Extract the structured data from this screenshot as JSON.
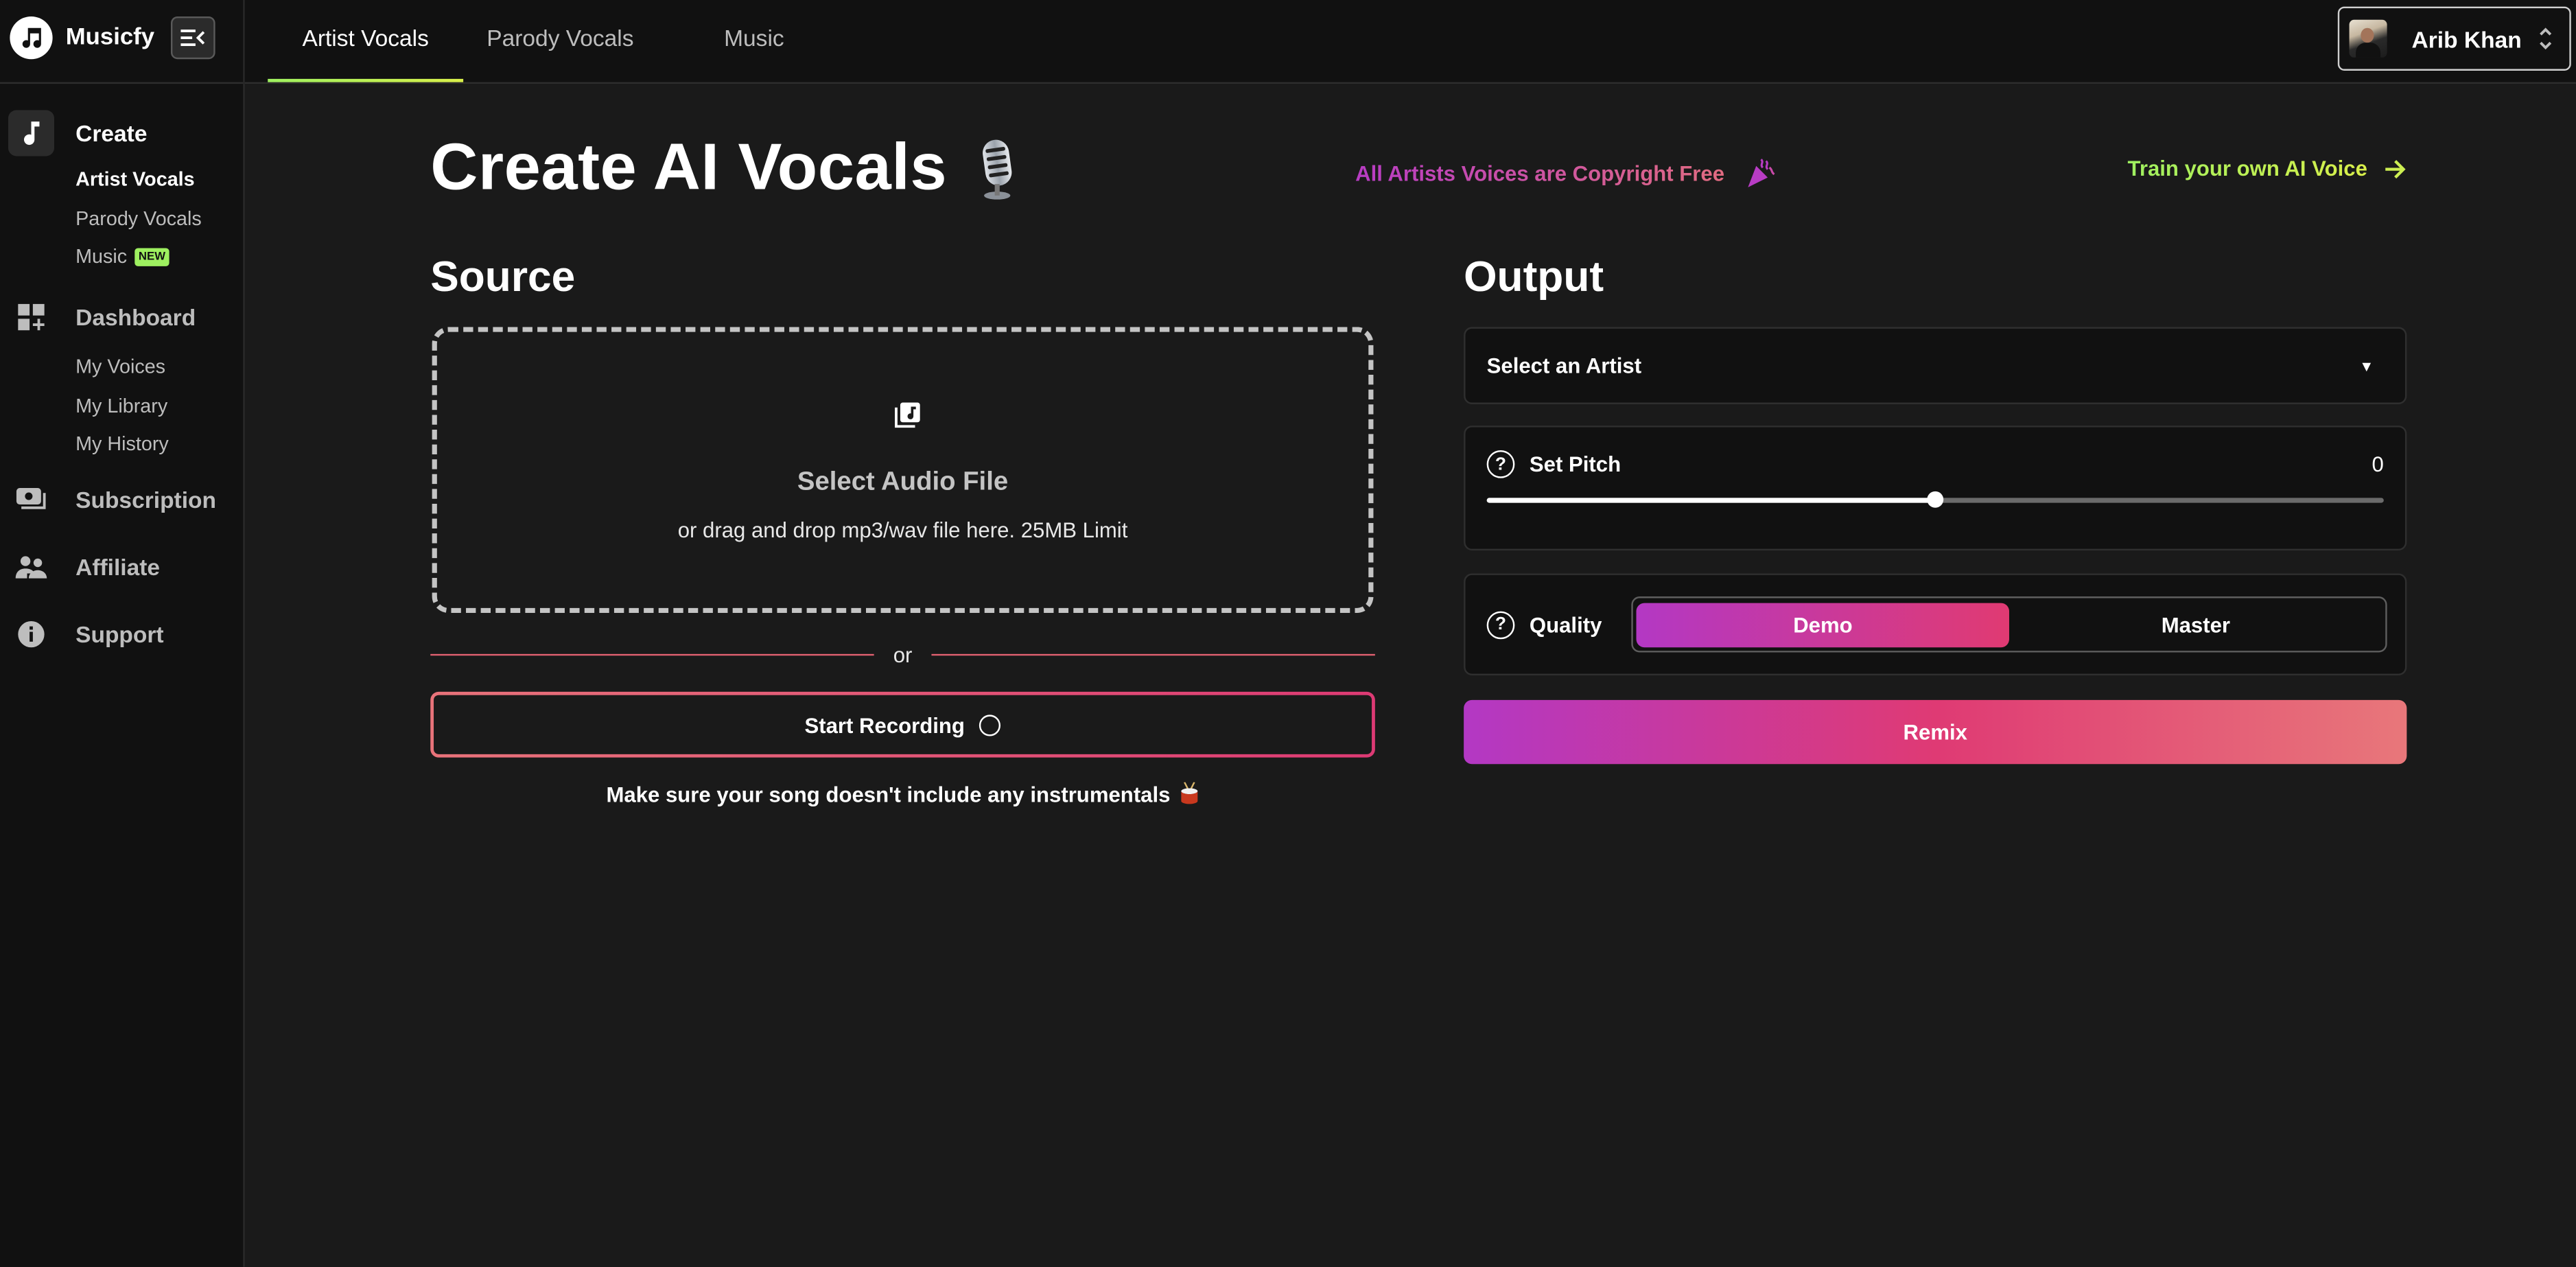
{
  "app": {
    "name": "Musicfy"
  },
  "sidebar": {
    "sections": [
      {
        "label": "Create",
        "icon": "music-note-icon",
        "active": true,
        "items": [
          {
            "label": "Artist Vocals",
            "active": true
          },
          {
            "label": "Parody Vocals"
          },
          {
            "label": "Music",
            "badge": "NEW"
          }
        ]
      },
      {
        "label": "Dashboard",
        "icon": "dashboard-add-icon",
        "items": [
          {
            "label": "My Voices"
          },
          {
            "label": "My Library"
          },
          {
            "label": "My History"
          }
        ]
      },
      {
        "label": "Subscription",
        "icon": "payments-icon",
        "items": []
      },
      {
        "label": "Affiliate",
        "icon": "people-icon",
        "items": []
      },
      {
        "label": "Support",
        "icon": "info-icon",
        "items": []
      }
    ]
  },
  "topbar": {
    "tabs": [
      {
        "label": "Artist Vocals",
        "active": true
      },
      {
        "label": "Parody Vocals"
      },
      {
        "label": "Music"
      }
    ],
    "user": {
      "name": "Arib Khan"
    }
  },
  "main": {
    "title": "Create AI Vocals",
    "title_emoji": "studio-microphone",
    "copyright_note": "All Artists Voices are Copyright Free",
    "train_link": "Train your own AI Voice",
    "source": {
      "heading": "Source",
      "dropzone_title": "Select Audio File",
      "dropzone_subtitle": "or drag and drop mp3/wav file here. 25MB Limit",
      "or_label": "or",
      "record_button": "Start Recording",
      "note": "Make sure your song doesn't include any instrumentals",
      "note_emoji": "drum"
    },
    "output": {
      "heading": "Output",
      "artist_select": {
        "placeholder": "Select an Artist"
      },
      "pitch": {
        "label": "Set Pitch",
        "value": "0",
        "min": -12,
        "max": 12,
        "current": 0
      },
      "quality": {
        "label": "Quality",
        "options": [
          {
            "label": "Demo",
            "active": true
          },
          {
            "label": "Master"
          }
        ]
      },
      "remix_button": "Remix"
    }
  },
  "colors": {
    "accent_green": "#9ef060",
    "accent_magenta": "#b338c4",
    "accent_pink": "#e03a72",
    "accent_coral": "#e8777a"
  }
}
